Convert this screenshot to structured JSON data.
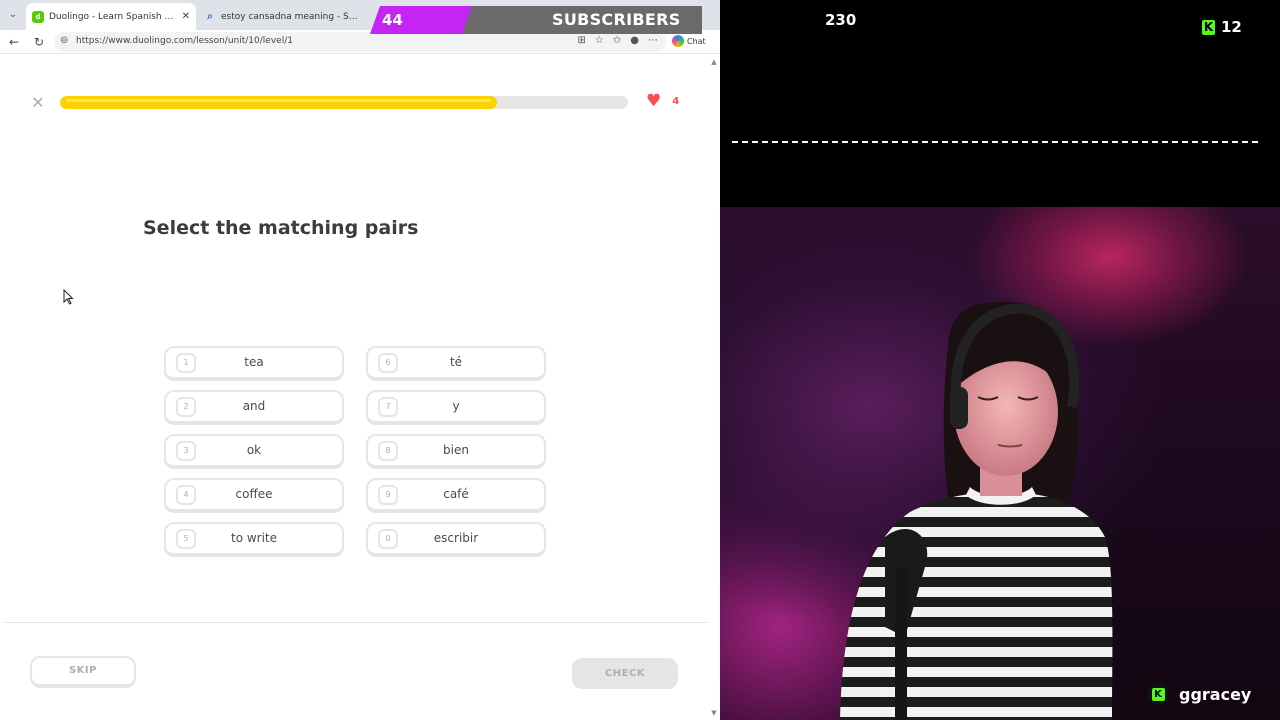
{
  "browser": {
    "tabs": [
      {
        "label": "Duolingo - Learn Spanish with les",
        "favicon": "duolingo-favicon",
        "active": true
      },
      {
        "label": "estoy cansadna meaning - Search",
        "favicon": "search-favicon",
        "active": false
      }
    ],
    "url": "https://www.duolingo.com/lesson/unit/10/level/1",
    "chat_label": "Chat"
  },
  "lesson": {
    "progress_fraction": 0.77,
    "hearts": "4",
    "prompt": "Select the matching pairs",
    "left_options": [
      {
        "key": "1",
        "text": "tea"
      },
      {
        "key": "2",
        "text": "and"
      },
      {
        "key": "3",
        "text": "ok"
      },
      {
        "key": "4",
        "text": "coffee"
      },
      {
        "key": "5",
        "text": "to write"
      }
    ],
    "right_options": [
      {
        "key": "6",
        "text": "té"
      },
      {
        "key": "7",
        "text": "y"
      },
      {
        "key": "8",
        "text": "bien"
      },
      {
        "key": "9",
        "text": "café"
      },
      {
        "key": "0",
        "text": "escribir"
      }
    ],
    "skip_label": "SKIP",
    "check_label": "CHECK"
  },
  "overlay": {
    "subscriber_count": "44",
    "subscriber_label": "SUBSCRIBERS",
    "viewer_count": "230",
    "kick_count": "12",
    "streamer_name": "ggracey"
  },
  "colors": {
    "progress": "#fbd300",
    "heart": "#ff4b4b",
    "subscriber_accent": "#c424f4",
    "kick_green": "#53fc18"
  }
}
